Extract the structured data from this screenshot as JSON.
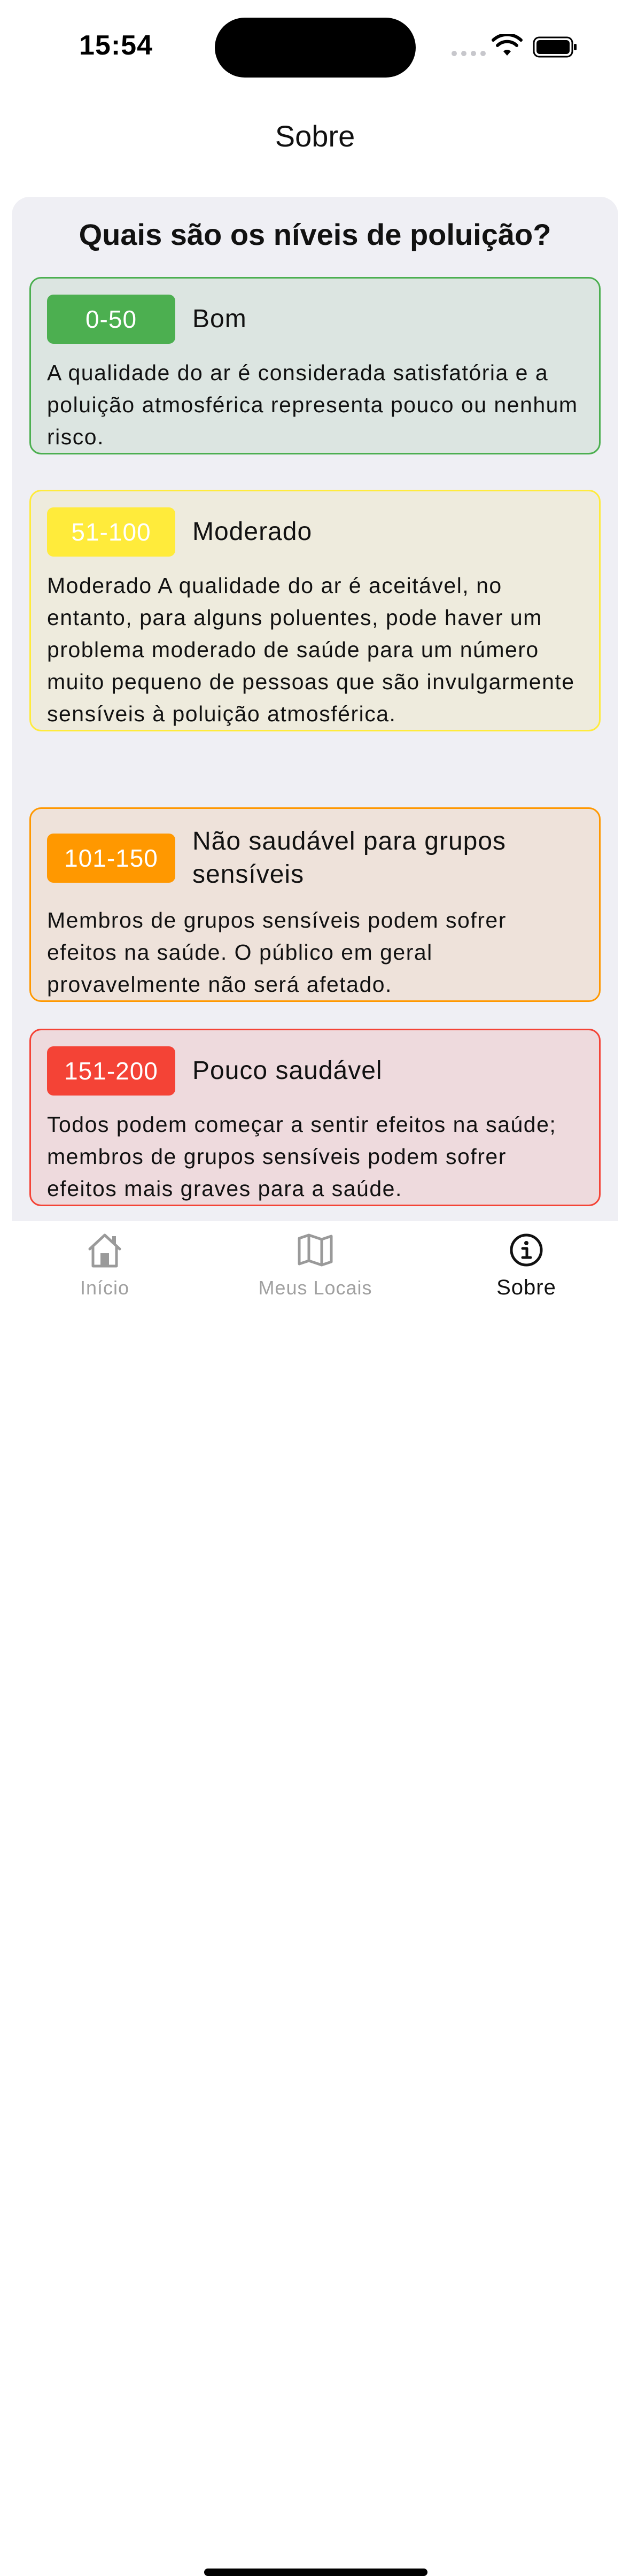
{
  "status_bar": {
    "time": "15:54"
  },
  "header": {
    "title": "Sobre"
  },
  "content": {
    "heading": "Quais são os níveis de poluição?",
    "levels": [
      {
        "range": "0-50",
        "title": "Bom",
        "description": "A qualidade do ar é considerada satisfatória e a poluição atmosférica representa pouco ou nenhum risco.",
        "color": "#4caf50",
        "background": "#dce5e1"
      },
      {
        "range": "51-100",
        "title": "Moderado",
        "description": "Moderado A qualidade do ar é aceitável, no entanto, para alguns poluentes, pode haver um problema moderado de saúde para um número muito pequeno de pessoas que são invulgarmente sensíveis à poluição atmosférica.",
        "color": "#ffeb3b",
        "background": "#eeebdd"
      },
      {
        "range": "101-150",
        "title": "Não saudável para grupos sensíveis",
        "description": "Membros de grupos sensíveis podem sofrer efeitos na saúde. O público em geral provavelmente não será afetado.",
        "color": "#ff9800",
        "background": "#eee2da"
      },
      {
        "range": "151-200",
        "title": "Pouco saudável",
        "description": "Todos podem começar a sentir efeitos na saúde; membros de grupos sensíveis podem sofrer efeitos mais graves para a saúde.",
        "color": "#f44336",
        "background": "#eedadd"
      }
    ]
  },
  "tab_bar": {
    "tabs": [
      {
        "label": "Início",
        "icon": "home-icon",
        "active": false
      },
      {
        "label": "Meus Locais",
        "icon": "map-icon",
        "active": false
      },
      {
        "label": "Sobre",
        "icon": "info-icon",
        "active": true
      }
    ]
  }
}
